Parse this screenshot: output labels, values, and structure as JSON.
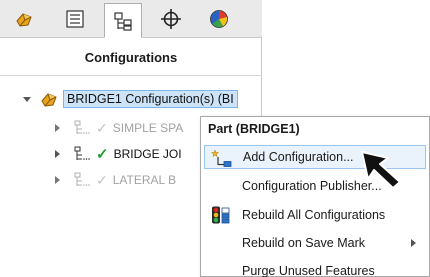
{
  "panel": {
    "title": "Configurations",
    "toolbar_tabs": [
      {
        "icon": "feature-manager-icon",
        "active": false
      },
      {
        "icon": "property-manager-icon",
        "active": false
      },
      {
        "icon": "configuration-manager-icon",
        "active": true
      },
      {
        "icon": "dimxpert-manager-icon",
        "active": false
      },
      {
        "icon": "display-manager-icon",
        "active": false
      }
    ]
  },
  "tree": {
    "root_label": "BRIDGE1 Configuration(s)  (BI",
    "items": [
      {
        "label": "SIMPLE SPA",
        "active": false
      },
      {
        "label": "BRIDGE JOI",
        "active": true
      },
      {
        "label": "LATERAL B",
        "active": false
      }
    ]
  },
  "context_menu": {
    "header": "Part (BRIDGE1)",
    "items": [
      {
        "label": "Add Configuration...",
        "icon": "add-configuration-icon",
        "highlighted": true
      },
      {
        "label": "Configuration Publisher...",
        "icon": "",
        "highlighted": false
      },
      {
        "label": "Rebuild All Configurations",
        "icon": "rebuild-all-configurations-icon",
        "highlighted": false
      },
      {
        "label": "Rebuild on Save Mark",
        "icon": "",
        "highlighted": false,
        "submenu": true
      },
      {
        "label": "Purge Unused Features",
        "icon": "",
        "highlighted": false
      }
    ]
  },
  "colors": {
    "selection_fill": "#cde3f7",
    "selection_border": "#7eb4ea",
    "check_green": "#1f9d2e",
    "dim_text": "#a2a2a2"
  }
}
